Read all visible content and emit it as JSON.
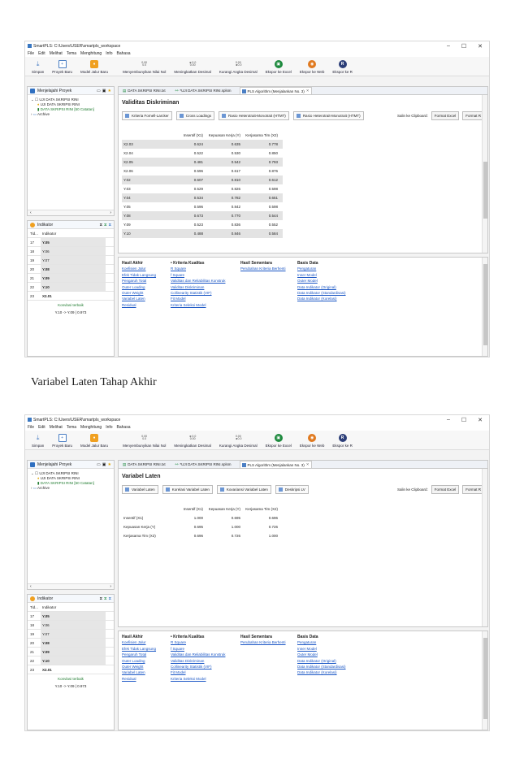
{
  "caption": "Variabel Laten Tahap Akhir",
  "window": {
    "title": "SmartPLS: C:\\Users\\USER\\smartpls_workspace",
    "controls": [
      "–",
      "☐",
      "✕"
    ]
  },
  "menu": [
    "File",
    "Edit",
    "Melihat",
    "Tema",
    "Menghitung",
    "Info",
    "Bahasa"
  ],
  "toolbar": [
    {
      "label": "Simpan",
      "icon": "save-icon"
    },
    {
      "label": "Proyek Baru",
      "icon": "new-project-icon"
    },
    {
      "label": "Model Jalur Baru",
      "icon": "new-path-model-icon"
    },
    {
      "label": "Menyembunyikan Nilai Nol",
      "icon": "hide-zero-icon",
      "glyph": "0.00\n0.0"
    },
    {
      "label": "Meningkatkan Desimal",
      "icon": "increase-decimal-icon",
      "glyph": "►0.0\n0.00"
    },
    {
      "label": "Kurangi Angka Desimal",
      "icon": "decrease-decimal-icon",
      "glyph": "0.00\n◄0.0"
    },
    {
      "label": "Ekspor ke Excel",
      "icon": "excel-icon"
    },
    {
      "label": "Ekspor ke Web",
      "icon": "web-icon"
    },
    {
      "label": "Ekspor ke R",
      "icon": "r-icon"
    }
  ],
  "explorer": {
    "title": "Menjelajahi Proyek",
    "items": [
      "UJI DATA SKRIPSI RINI",
      "UJI DATA SKRIPSI RINI",
      "DATA SKRIPSI RINI [50 Catatan]",
      "Archive"
    ]
  },
  "indicators": {
    "title": "Indikator",
    "headers": [
      "Tid...",
      "Indikator"
    ],
    "rows": [
      {
        "id": "17",
        "name": "Y.05"
      },
      {
        "id": "18",
        "name": "Y.06"
      },
      {
        "id": "19",
        "name": "Y.07"
      },
      {
        "id": "20",
        "name": "Y.08"
      },
      {
        "id": "21",
        "name": "Y.09"
      },
      {
        "id": "22",
        "name": "Y.10"
      },
      {
        "id": "23",
        "name": "X2.01"
      }
    ],
    "convergence_label": "Konvlasi terbaik",
    "convergence_value": "Y.10 -> Y.09 | 0.973"
  },
  "tabs": [
    "DATA SKRIPSI RINI.txt",
    "*UJI DATA SKRIPSI RINI.splsm",
    "PLS Algorithm (Menjalankan No. 3)"
  ],
  "bottom": {
    "columns": [
      {
        "head": "Hasil Akhir",
        "links": [
          "Koefisien Jalur",
          "Efek Tidak Langsung",
          "Pengaruh Total",
          "Outer Loading",
          "Outer Weight",
          "Variabel Laten",
          "Residual"
        ]
      },
      {
        "head": "• Kriteria Kualitas",
        "links": [
          "R Square",
          "f Square",
          "Validitas dan Reliabilitas Konstruk",
          "Validitas Diskriminan",
          "Collinearity Statistik (VIF)",
          "Fit Model",
          "Kriteria Seleksi Model"
        ]
      },
      {
        "head": "Hasil Sementara",
        "links": [
          "Perubahan Kriteria Berhenti"
        ]
      },
      {
        "head": "Basis Data",
        "links": [
          "Pengaturan",
          "Inner Model",
          "Outer Model",
          "Data Indikator (Original)",
          "Data Indikator (Standardisasi)",
          "Data Indikator (Korelasi)"
        ]
      }
    ]
  },
  "shot1": {
    "heading": "Validitas Diskriminan",
    "buttons": [
      "Kriteria Fornell-Larcker",
      "Cross Loadings",
      "Rasio Heterotrait-Monotrait (HTMT)",
      "Rasio Heterotrait-Monotrait (HTMT)"
    ],
    "clipboard": "Salin ke Clipboard:",
    "format_buttons": [
      "Format Excel",
      "Format R"
    ],
    "columns": [
      "",
      "Insentif (X1)",
      "Kepuasan Kerja (Y)",
      "Kerjasama Tim (X2)"
    ],
    "rows": [
      [
        "X2.03",
        "0.624",
        "0.635",
        "0.778"
      ],
      [
        "X2.04",
        "0.522",
        "0.530",
        "0.850"
      ],
      [
        "X2.05",
        "0.481",
        "0.542",
        "0.793"
      ],
      [
        "X2.06",
        "0.596",
        "0.617",
        "0.876"
      ],
      [
        "Y.02",
        "0.607",
        "0.810",
        "0.612"
      ],
      [
        "Y.03",
        "0.529",
        "0.826",
        "0.598"
      ],
      [
        "Y.04",
        "0.534",
        "0.782",
        "0.651"
      ],
      [
        "Y.05",
        "0.596",
        "0.842",
        "0.598"
      ],
      [
        "Y.08",
        "0.673",
        "0.770",
        "0.544"
      ],
      [
        "Y.09",
        "0.523",
        "0.836",
        "0.552"
      ],
      [
        "Y.10",
        "0.488",
        "0.846",
        "0.584"
      ]
    ]
  },
  "shot2": {
    "heading": "Variabel Laten",
    "buttons": [
      "Variabel Laten",
      "Korelasi Variabel Laten",
      "Kovariansi Variabel Laten",
      "Deskripsi LV"
    ],
    "clipboard": "Salin ke Clipboard:",
    "format_buttons": [
      "Format Excel",
      "Format R"
    ],
    "columns": [
      "",
      "Insentif (X1)",
      "Kepuasan Kerja (Y)",
      "Kerjasama Tim (X2)"
    ],
    "rows": [
      [
        "Insentif (X1)",
        "1.000",
        "0.695",
        "0.696"
      ],
      [
        "Kepuasan Kerja (Y)",
        "0.695",
        "1.000",
        "0.726"
      ],
      [
        "Kerjasama Tim (X2)",
        "0.696",
        "0.726",
        "1.000"
      ]
    ]
  }
}
